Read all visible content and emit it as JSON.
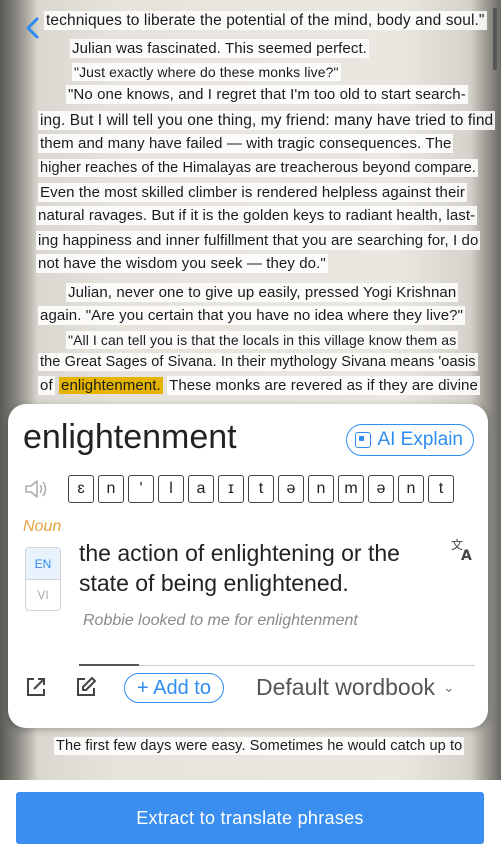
{
  "page_text": {
    "lines": [
      "techniques to liberate the potential of the mind, body and soul.\"",
      "Julian was fascinated. This seemed perfect.",
      "\"Just exactly where do these monks live?\"",
      "\"No one knows, and I regret that I'm too old to start search-",
      "ing. But I will tell you one thing, my friend: many have tried to find",
      "them and many have failed — with tragic consequences. The",
      "higher reaches of the Himalayas are treacherous beyond compare.",
      "Even the most skilled climber is rendered helpless against their",
      "natural ravages. But if it is the golden keys to radiant health, last-",
      "ing happiness and inner fulfillment that you are searching for, I do",
      "not have the wisdom you seek — they do.\"",
      "Julian, never one to give up easily, pressed Yogi Krishnan",
      "again. \"Are you certain that you have no idea where they live?\"",
      "\"All I can tell you is that the locals in this village know them as",
      "the Great Sages of Sivana. In their mythology Sivana means 'oasis",
      "of",
      "enlightenment.",
      "These monks are revered as if they are divine",
      "The first few days were easy. Sometimes he would catch up to"
    ]
  },
  "card": {
    "word": "enlightenment",
    "ai_label": "AI Explain",
    "phonemes": [
      "ɛ",
      "n",
      "'",
      "l",
      "a",
      "ɪ",
      "t",
      "ə",
      "n",
      "m",
      "ə",
      "n",
      "t"
    ],
    "part_of_speech": "Noun",
    "lang_en": "EN",
    "lang_vi": "VI",
    "definition": "the action of enlightening or the state of being enlightened.",
    "example": "Robbie looked to me for enlightenment",
    "add_to_label": "+ Add to",
    "wordbook": "Default wordbook"
  },
  "footer": {
    "extract_label": "Extract to translate phrases"
  },
  "colors": {
    "accent": "#2f8cf0",
    "highlight": "#e4b400",
    "pos": "#e8a33c",
    "button": "#3a8ef0"
  }
}
